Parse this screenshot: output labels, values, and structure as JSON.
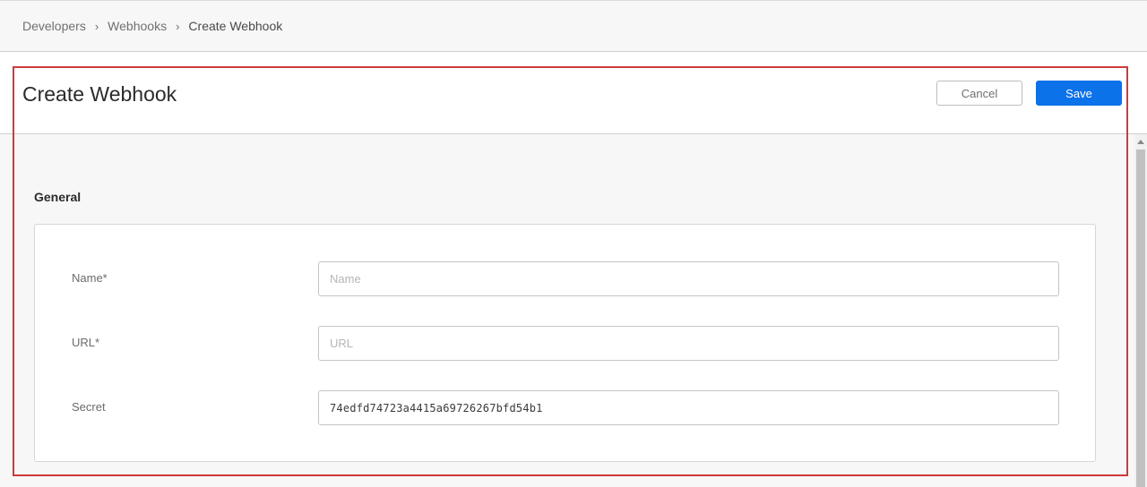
{
  "breadcrumb": {
    "items": [
      "Developers",
      "Webhooks",
      "Create Webhook"
    ],
    "separator": "›"
  },
  "header": {
    "title": "Create Webhook",
    "cancel_label": "Cancel",
    "save_label": "Save"
  },
  "section": {
    "title": "General"
  },
  "form": {
    "name": {
      "label": "Name*",
      "value": "",
      "placeholder": "Name"
    },
    "url": {
      "label": "URL*",
      "value": "",
      "placeholder": "URL"
    },
    "secret": {
      "label": "Secret",
      "value": "74edfd74723a4415a69726267bfd54b1",
      "placeholder": ""
    }
  },
  "colors": {
    "accent": "#0b72ea",
    "highlight": "#d0393b"
  }
}
